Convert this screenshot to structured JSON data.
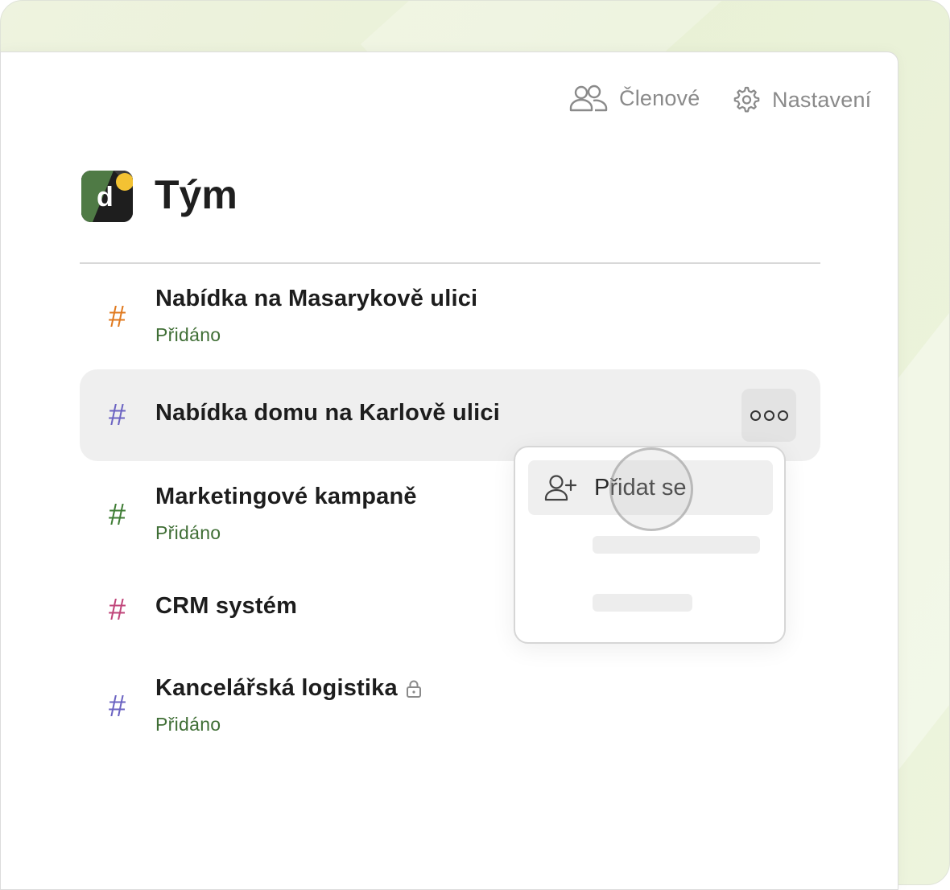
{
  "header": {
    "members_label": "Členové",
    "settings_label": "Nastavení"
  },
  "team": {
    "title": "Tým",
    "logo_letter": "d"
  },
  "channels": [
    {
      "name": "Nabídka na Masarykově ulici",
      "status": "Přidáno",
      "hash_color": "#e07a1f"
    },
    {
      "name": "Nabídka domu na Karlově ulici",
      "status": "",
      "hash_color": "#6b63c2"
    },
    {
      "name": "Marketingové kampaně",
      "status": "Přidáno",
      "hash_color": "#3f7d35"
    },
    {
      "name": "CRM systém",
      "status": "",
      "hash_color": "#c0457a"
    },
    {
      "name": "Kancelářská logistika",
      "status": "Přidáno",
      "hash_color": "#6b63c2",
      "locked": true
    }
  ],
  "menu": {
    "join_label": "Přidat se"
  },
  "colors": {
    "status_green": "#3f6e35",
    "accent_yellow": "#f3c233"
  },
  "hash_symbol": "#"
}
